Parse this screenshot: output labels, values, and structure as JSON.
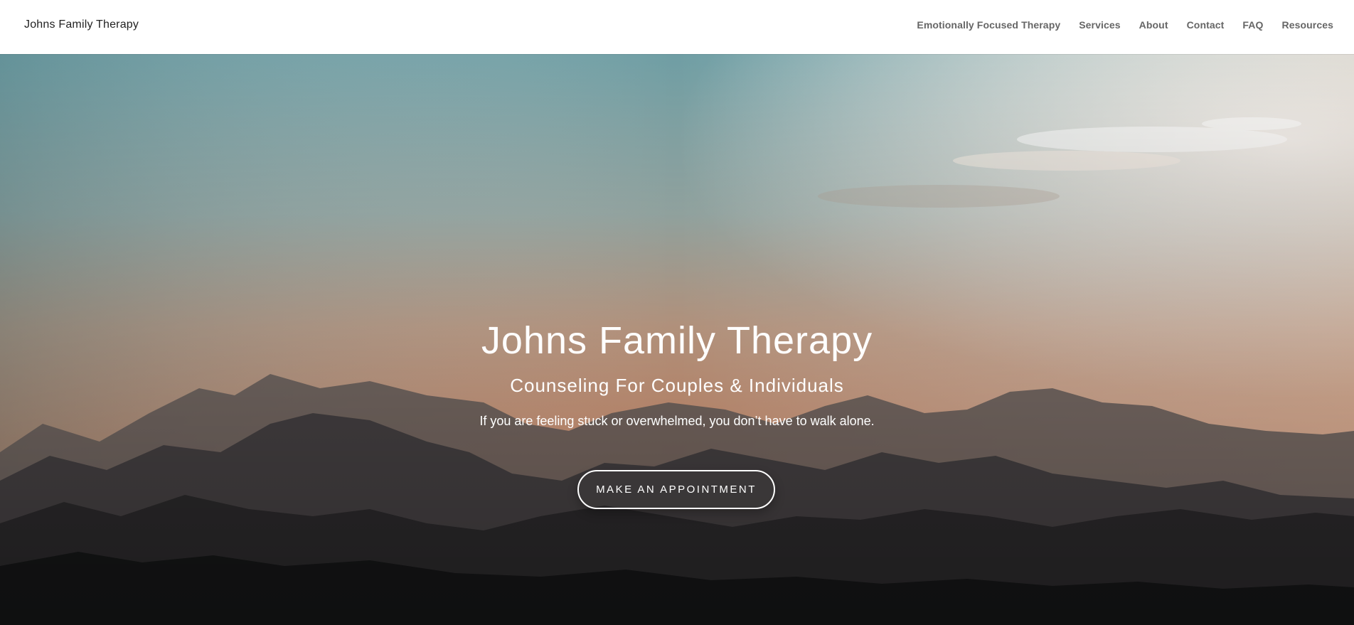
{
  "header": {
    "site_title": "Johns Family Therapy",
    "nav": [
      {
        "label": "Emotionally Focused Therapy"
      },
      {
        "label": "Services"
      },
      {
        "label": "About"
      },
      {
        "label": "Contact"
      },
      {
        "label": "FAQ"
      },
      {
        "label": "Resources"
      }
    ]
  },
  "hero": {
    "title": "Johns Family Therapy",
    "subtitle": "Counseling For Couples & Individuals",
    "text": "If you are feeling stuck or overwhelmed, you don’t have to walk alone.",
    "cta_label": "MAKE AN APPOINTMENT"
  },
  "colors": {
    "sky_top": "#7ea6ab",
    "sky_warm": "#f0a98a",
    "mountain_dark": "#1f1f21"
  }
}
